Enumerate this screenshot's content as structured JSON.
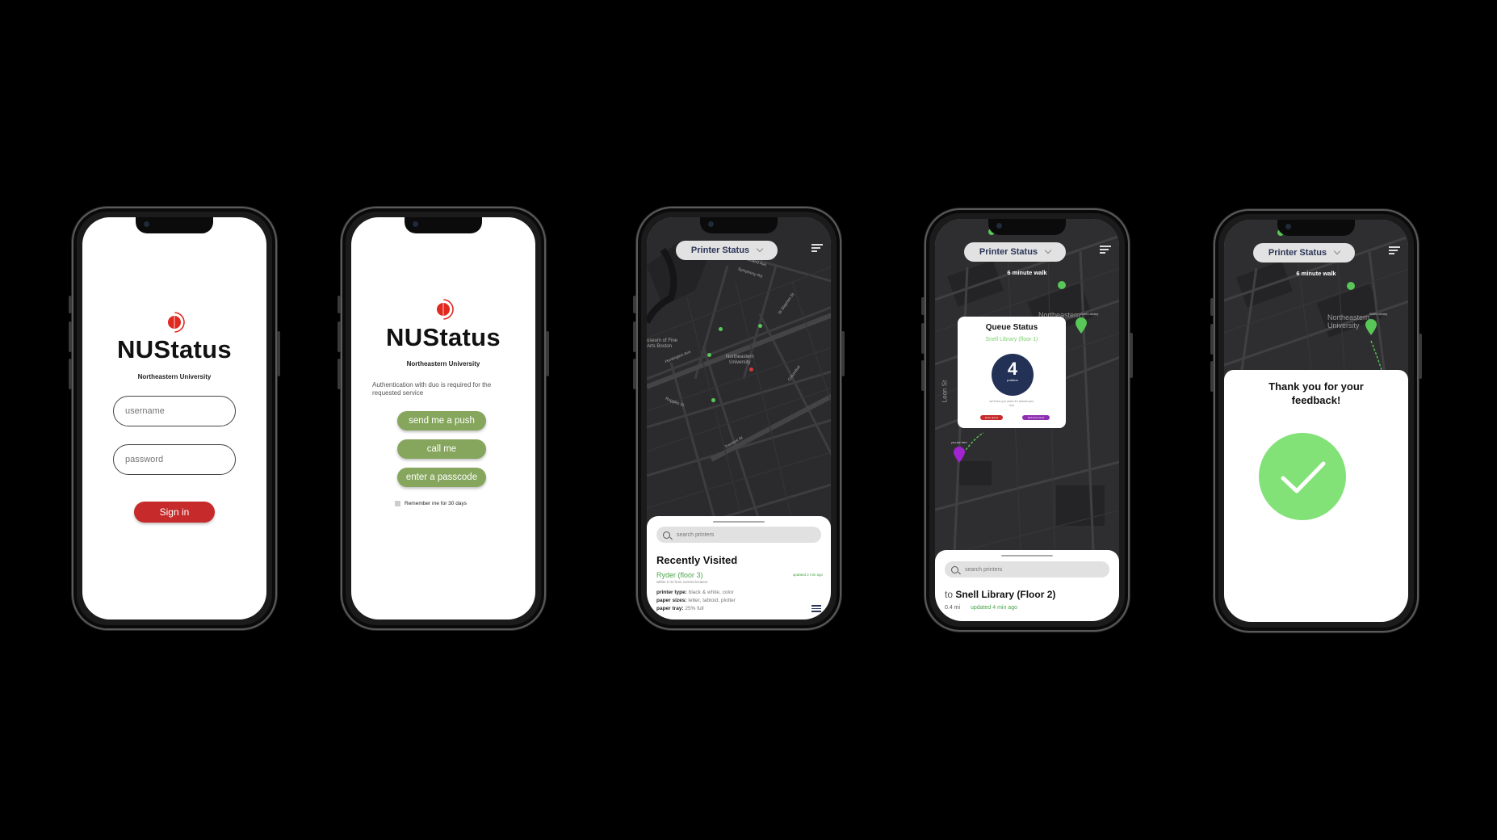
{
  "phone1": {
    "brand": "NUStatus",
    "university": "Northeastern University",
    "username_placeholder": "username",
    "password_placeholder": "password",
    "signin_label": "Sign in"
  },
  "phone2": {
    "brand": "NUStatus",
    "university": "Northeastern University",
    "auth_text": "Authentication with duo is required for the requested service",
    "push_label": "send me a push",
    "call_label": "call me",
    "passcode_label": "enter a passcode",
    "remember_label": "Remember me for 30 days"
  },
  "phone3": {
    "dropdown": "Printer Status",
    "map_labels": {
      "museum": "useum of Fine\nArts Boston",
      "campus": "Northeastern\nUniversity",
      "huntington": "Huntington Ave",
      "symphony": "Symphony Rd",
      "westland": "Westland Ave",
      "ruggles": "Ruggles St",
      "tremont": "Tremont St",
      "st_stephen": "St Stephen St",
      "columbus": "Columbus"
    },
    "search_placeholder": "search printers",
    "section_title": "Recently Visited",
    "printer": {
      "name": "Ryder (floor 3)",
      "updated": "updated 2 min ago",
      "distance": "within 0 mi from current location",
      "type_label": "printer type:",
      "type_value": "black & white, color",
      "sizes_label": "paper sizes:",
      "sizes_value": "letter, tabloid, plotter",
      "tray_label": "paper tray:",
      "tray_value": "25% full"
    }
  },
  "phone4": {
    "dropdown": "Printer Status",
    "walk": "6 minute walk",
    "queue_title": "Queue Status",
    "queue_location": "Snell Library (floor 1)",
    "position_number": "4",
    "position_label": "position",
    "text_note": "we'll text you when it's almost your turn",
    "leave_queue": "leave queue",
    "add_documents": "add documents",
    "map_labels": {
      "campus": "Northeastern",
      "snell": "Snell Library",
      "leon": "Leon St",
      "you": "you are here"
    },
    "search_placeholder": "search printers",
    "destination_prefix": "to",
    "destination": "Snell Library (Floor 2)",
    "distance": "0.4 mi",
    "updated": "updated 4 min ago"
  },
  "phone5": {
    "dropdown": "Printer Status",
    "walk": "6 minute walk",
    "map_labels": {
      "campus": "Northeastern\nUniversity",
      "snell": "Snell Library"
    },
    "thanks": "Thank you for your feedback!"
  },
  "colors": {
    "brand_red": "#c62a2a",
    "duo_green": "#85a65c",
    "status_green": "#58c758",
    "navy": "#223155",
    "check_green": "#82e277"
  }
}
